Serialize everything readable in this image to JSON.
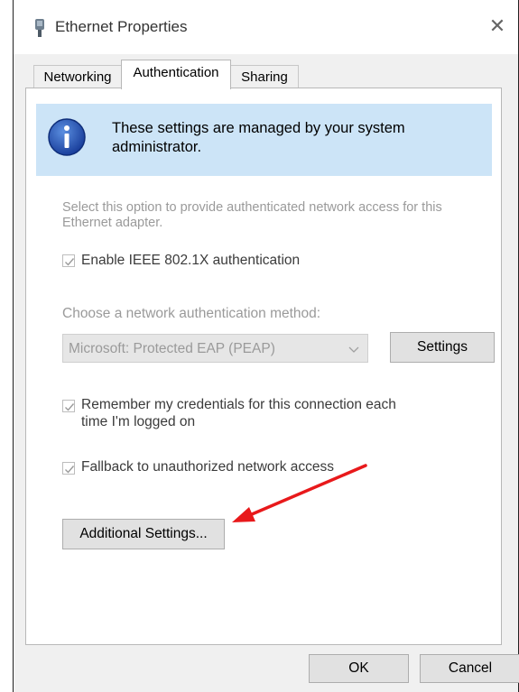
{
  "window": {
    "title": "Ethernet Properties",
    "icon": "ethernet-adapter-icon",
    "close_icon": "close-icon"
  },
  "tabs": [
    {
      "label": "Networking",
      "active": false
    },
    {
      "label": "Authentication",
      "active": true
    },
    {
      "label": "Sharing",
      "active": false
    }
  ],
  "info_banner": {
    "icon": "info-icon",
    "text": "These settings are managed by your system administrator."
  },
  "description": "Select this option to provide authenticated network access for this Ethernet adapter.",
  "enable_8021x": {
    "label": "Enable IEEE 802.1X authentication",
    "checked": true
  },
  "method": {
    "label": "Choose a network authentication method:",
    "selected": "Microsoft: Protected EAP (PEAP)",
    "settings_button": "Settings"
  },
  "remember_credentials": {
    "label": "Remember my credentials for this connection each time I'm logged on",
    "checked": true
  },
  "fallback": {
    "label": "Fallback to unauthorized network access",
    "checked": true
  },
  "additional_settings_button": "Additional Settings...",
  "footer": {
    "ok": "OK",
    "cancel": "Cancel"
  },
  "colors": {
    "info_bg": "#cce4f7",
    "annotation_arrow": "#e8191b",
    "disabled_text": "#9a9a9a"
  }
}
